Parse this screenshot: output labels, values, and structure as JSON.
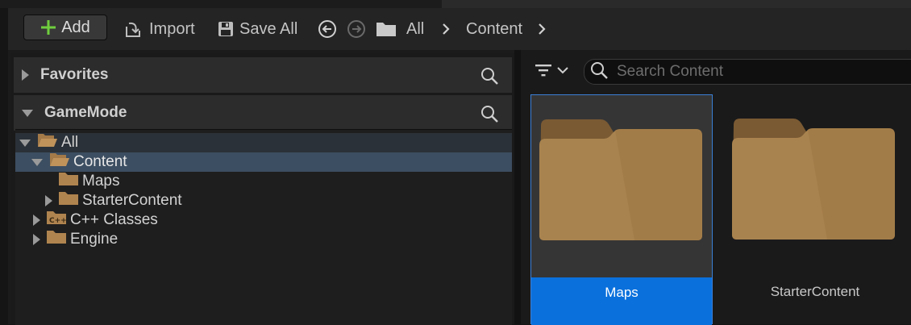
{
  "toolbar": {
    "add_label": "Add",
    "import_label": "Import",
    "save_all_label": "Save All"
  },
  "breadcrumb": {
    "items": [
      "All",
      "Content"
    ]
  },
  "left_panel": {
    "favorites_label": "Favorites",
    "project_label": "GameMode",
    "tree": [
      {
        "label": "All",
        "expanded": true
      },
      {
        "label": "Content",
        "expanded": true,
        "selected": true
      },
      {
        "label": "Maps"
      },
      {
        "label": "StarterContent"
      },
      {
        "label": "C++ Classes"
      },
      {
        "label": "Engine"
      }
    ]
  },
  "right_panel": {
    "search_placeholder": "Search Content",
    "tiles": [
      {
        "label": "Maps",
        "selected": true
      },
      {
        "label": "StarterContent",
        "selected": false
      }
    ]
  },
  "colors": {
    "selection_blue": "#0a70dc",
    "tree_selection": "#3c4e61",
    "folder": "#a0784a",
    "add_icon_green": "#6fcf3e"
  },
  "icons": [
    "plus-icon",
    "import-icon",
    "save-icon",
    "back-arrow-icon",
    "forward-arrow-icon",
    "folder-icon",
    "chevron-right-icon",
    "search-icon",
    "filter-icon",
    "chevron-down-icon",
    "cpp-folder-icon"
  ]
}
